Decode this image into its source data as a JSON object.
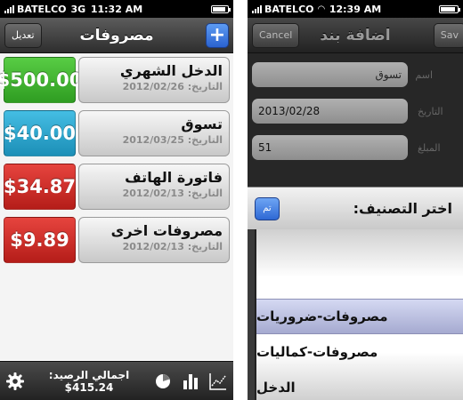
{
  "left": {
    "status": {
      "carrier": "BATELCO",
      "network": "3G",
      "time": "11:32 AM"
    },
    "nav": {
      "edit_label": "تعديل",
      "title": "مصروفات",
      "add_label": "+"
    },
    "entries": [
      {
        "title": "الدخل الشهري",
        "date": "التاريخ: 2012/02/26",
        "amount": "$500.00",
        "color": "#3db52f"
      },
      {
        "title": "تسوق",
        "date": "التاريخ: 2012/03/25",
        "amount": "$40.00",
        "color": "#27a6cf"
      },
      {
        "title": "فاتورة الهاتف",
        "date": "التاريخ: 2012/02/13",
        "amount": "$34.87",
        "color": "#d42a25"
      },
      {
        "title": "مصروفات اخرى",
        "date": "التاريخ: 2012/02/13",
        "amount": "$9.89",
        "color": "#d42a25"
      }
    ],
    "toolbar": {
      "balance": "اجمالي الرصيد: 415.24$",
      "icons": [
        "gear-icon",
        "pie-chart-icon",
        "bar-chart-icon",
        "line-chart-icon"
      ]
    }
  },
  "right": {
    "status": {
      "carrier": "BATELCO",
      "time": "12:39 AM"
    },
    "nav": {
      "cancel_label": "Cancel",
      "title": "اضافة بند",
      "save_label": "Sav"
    },
    "form": {
      "name_label": "اسم",
      "name_value": "تسوق",
      "date_label": "التاريخ",
      "date_value": "2013/02/28",
      "amount_label": "المبلغ",
      "amount_value": "51"
    },
    "picker": {
      "title": "اختر التصنيف:",
      "done_label": "تم",
      "options": [
        "مصروفات-ضروريات",
        "مصروفات-كماليات",
        "الدخل"
      ],
      "selected": "مصروفات-ضروريات"
    }
  }
}
